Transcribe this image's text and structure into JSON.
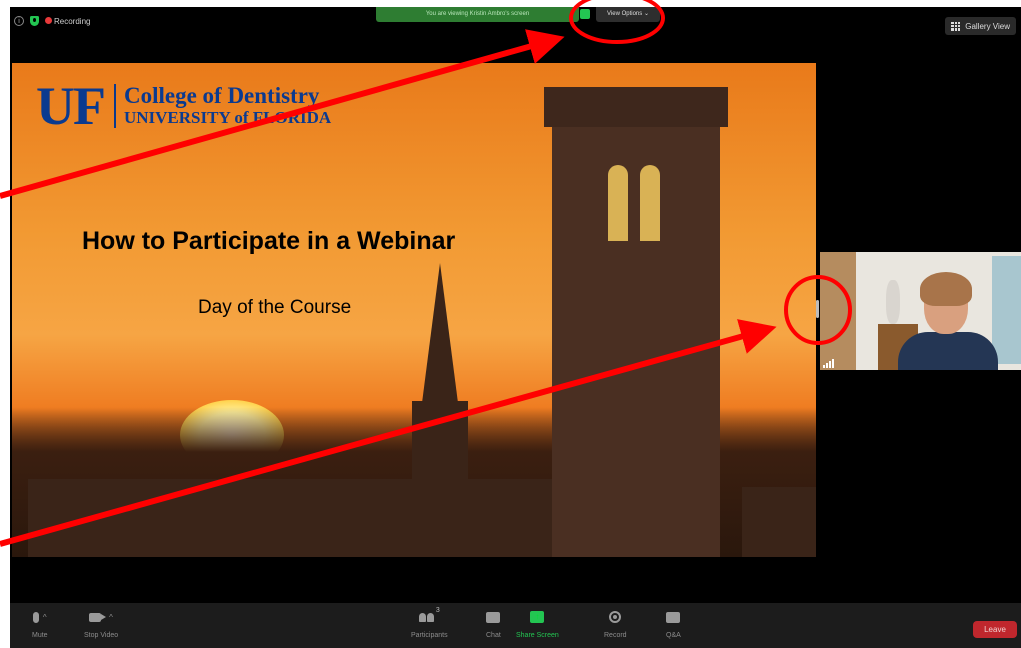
{
  "top_bar": {
    "recording_label": "Recording",
    "share_banner_text": "You are viewing Kristin Ambro's screen",
    "view_options_label": "View Options ⌄",
    "gallery_view_label": "Gallery View"
  },
  "slide": {
    "logo_letters": "UF",
    "college_name": "College of Dentistry",
    "university_name": "UNIVERSITY of FLORIDA",
    "title": "How to Participate in a Webinar",
    "subtitle": "Day of the Course"
  },
  "toolbar": {
    "mute_label": "Mute",
    "stop_video_label": "Stop Video",
    "participants_label": "Participants",
    "participants_count": "3",
    "chat_label": "Chat",
    "share_screen_label": "Share Screen",
    "record_label": "Record",
    "qa_label": "Q&A",
    "leave_label": "Leave"
  },
  "colors": {
    "annotation_red": "#ff0000",
    "share_green": "#23c552",
    "leave_red": "#c0272d",
    "uf_blue": "#0b3a8f"
  }
}
